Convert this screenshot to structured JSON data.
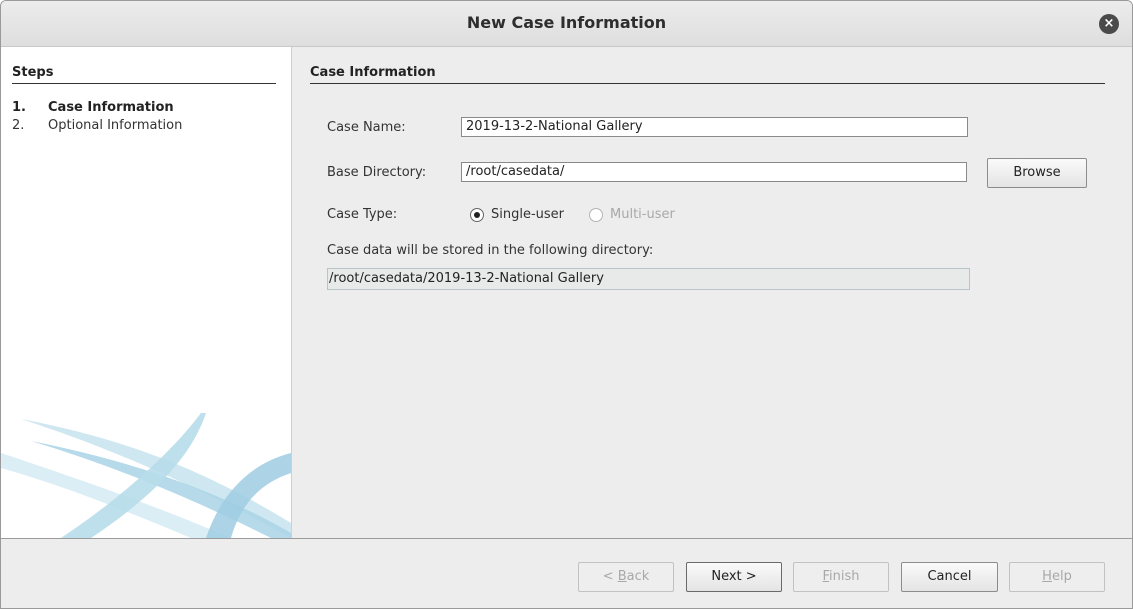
{
  "window": {
    "title": "New Case Information",
    "close_icon": "×"
  },
  "steps": {
    "header": "Steps",
    "items": [
      {
        "num": "1.",
        "label": "Case Information",
        "active": true
      },
      {
        "num": "2.",
        "label": "Optional Information",
        "active": false
      }
    ]
  },
  "form": {
    "section_title": "Case Information",
    "case_name_label": "Case Name:",
    "case_name_value": "2019-13-2-National Gallery",
    "base_dir_label": "Base Directory:",
    "base_dir_value": "/root/casedata/",
    "browse_label": "Browse",
    "case_type_label": "Case Type:",
    "single_user_label": "Single-user",
    "multi_user_label": "Multi-user",
    "storage_note": "Case data will be stored in the following directory:",
    "storage_path": "/root/casedata/2019-13-2-National Gallery"
  },
  "buttons": {
    "back_prefix": "< ",
    "back_mnemonic": "B",
    "back_rest": "ack",
    "next": "Next >",
    "finish_mnemonic": "F",
    "finish_rest": "inish",
    "cancel": "Cancel",
    "help_mnemonic": "H",
    "help_rest": "elp"
  },
  "colors": {
    "panel_bg": "#ededed",
    "swoosh": "#a9d3e6"
  }
}
